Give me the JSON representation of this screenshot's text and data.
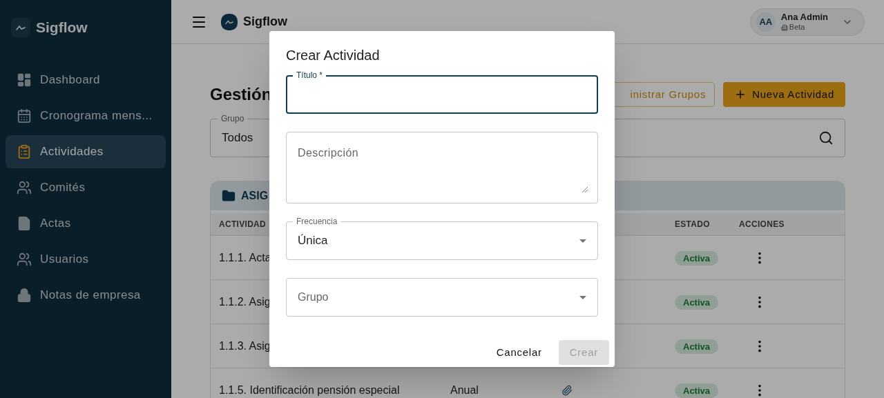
{
  "sidebar": {
    "brand": "Sigflow",
    "items": [
      {
        "label": "Dashboard",
        "selected": false
      },
      {
        "label": "Cronograma mens...",
        "selected": false
      },
      {
        "label": "Actividades",
        "selected": true
      },
      {
        "label": "Comités",
        "selected": false
      },
      {
        "label": "Actas",
        "selected": false
      },
      {
        "label": "Usuarios",
        "selected": false
      },
      {
        "label": "Notas de empresa",
        "selected": false
      }
    ]
  },
  "header": {
    "brand": "Sigflow",
    "user": {
      "initials": "AA",
      "name": "Ana Admin",
      "org": "Beta"
    }
  },
  "page": {
    "title": "Gestión",
    "buttons": [
      {
        "label": "inistrar Grupos",
        "kind": "outlined"
      },
      {
        "label": "Nueva Actividad",
        "kind": "contained"
      }
    ],
    "filter": {
      "label": "Grupo",
      "value": "Todos"
    },
    "group": {
      "name": "ASIG"
    },
    "columns": [
      "ACTIVIDAD",
      "ESTADO",
      "ACCIONES"
    ],
    "rows": [
      {
        "activity": "1.1.1. Acta",
        "status": "Activa"
      },
      {
        "activity": "1.1.2. Asig",
        "status": "Activa"
      },
      {
        "activity": "1.1.3. Asig",
        "status": "Activa"
      },
      {
        "activity": "1.1.5. Identificación pensión especial",
        "column_2": "Anual",
        "attachment": true,
        "status": "Activa"
      }
    ]
  },
  "dialog": {
    "title": "Crear Actividad",
    "fields": [
      {
        "kind": "text",
        "label": "Título *",
        "focused": true
      },
      {
        "kind": "textarea",
        "placeholder": "Descripción"
      },
      {
        "kind": "select",
        "label": "Frecuencia",
        "value": "Única"
      },
      {
        "kind": "select",
        "placeholder": "Grupo"
      }
    ],
    "actions": [
      {
        "label": "Cancelar",
        "disabled": false
      },
      {
        "label": "Crear",
        "disabled": true
      }
    ]
  }
}
